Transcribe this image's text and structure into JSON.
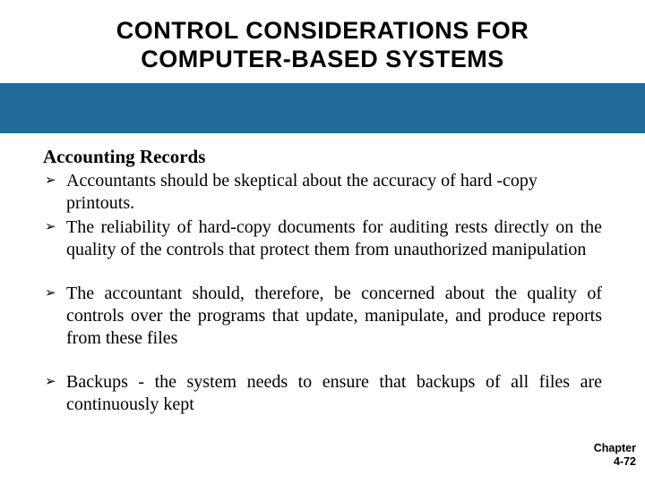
{
  "title": {
    "line1": "CONTROL CONSIDERATIONS FOR",
    "line2": "COMPUTER-BASED SYSTEMS"
  },
  "bar_color": "#1F6A97",
  "section_heading": "Accounting Records",
  "bullets": [
    "Accountants should be skeptical about the accuracy of hard -copy printouts.",
    "The reliability of hard-copy documents for auditing rests directly on the quality of the controls that protect them from unauthorized manipulation",
    "The accountant should, therefore, be concerned about the quality of controls over the programs that update, manipulate, and produce reports from these files",
    "Backups - the system needs to ensure that backups of all files are continuously kept"
  ],
  "bullet_marker": "➢",
  "footer": {
    "line1": "Chapter",
    "line2": "4-72"
  }
}
